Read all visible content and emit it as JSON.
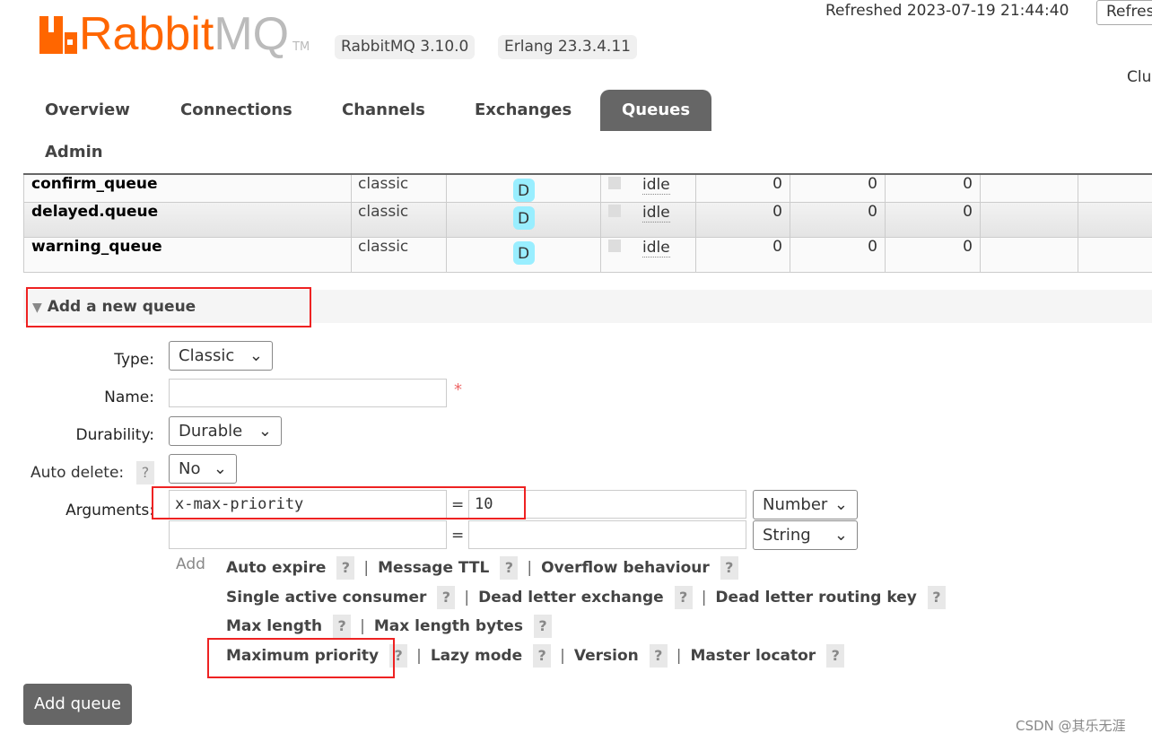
{
  "header": {
    "logo_text": "RabbitMQ",
    "logo_orange": "Rabbit",
    "logo_gray": "MQ",
    "trademark": "TM",
    "version": "RabbitMQ 3.10.0",
    "erlang": "Erlang 23.3.4.11",
    "refreshed": "Refreshed 2023-07-19 21:44:40",
    "refresh_button": "Refresh",
    "cluster": "Cluster"
  },
  "tabs": [
    {
      "label": "Overview"
    },
    {
      "label": "Connections"
    },
    {
      "label": "Channels"
    },
    {
      "label": "Exchanges"
    },
    {
      "label": "Queues",
      "active": true
    },
    {
      "label": "Admin"
    }
  ],
  "queues": [
    {
      "name": "confirm_queue",
      "type": "classic",
      "features": "D",
      "state": "idle",
      "ready": "0",
      "unacked": "0",
      "total": "0"
    },
    {
      "name": "delayed.queue",
      "type": "classic",
      "features": "D",
      "state": "idle",
      "ready": "0",
      "unacked": "0",
      "total": "0"
    },
    {
      "name": "warning_queue",
      "type": "classic",
      "features": "D",
      "state": "idle",
      "ready": "0",
      "unacked": "0",
      "total": "0"
    }
  ],
  "form": {
    "section_title": "Add a new queue",
    "type_label": "Type:",
    "type_value": "Classic",
    "name_label": "Name:",
    "name_value": "",
    "required": "*",
    "durability_label": "Durability:",
    "durability_value": "Durable",
    "autodelete_label": "Auto delete:",
    "autodelete_value": "No",
    "arguments_label": "Arguments:",
    "args": [
      {
        "key": "x-max-priority",
        "eq": "=",
        "value": "10",
        "type": "Number"
      },
      {
        "key": "",
        "eq": "=",
        "value": "",
        "type": "String"
      }
    ],
    "add_label": "Add",
    "help_q": "?",
    "help_rows": [
      [
        "Auto expire",
        "Message TTL",
        "Overflow behaviour"
      ],
      [
        "Single active consumer",
        "Dead letter exchange",
        "Dead letter routing key"
      ],
      [
        "Max length",
        "Max length bytes"
      ],
      [
        "Maximum priority",
        "Lazy mode",
        "Version",
        "Master locator"
      ]
    ],
    "submit": "Add queue"
  },
  "watermark": "CSDN @其乐无涯",
  "colors": {
    "brand": "#ff6600",
    "active_tab": "#666666",
    "highlight": "#ee2222",
    "badge": "#99eeff"
  }
}
